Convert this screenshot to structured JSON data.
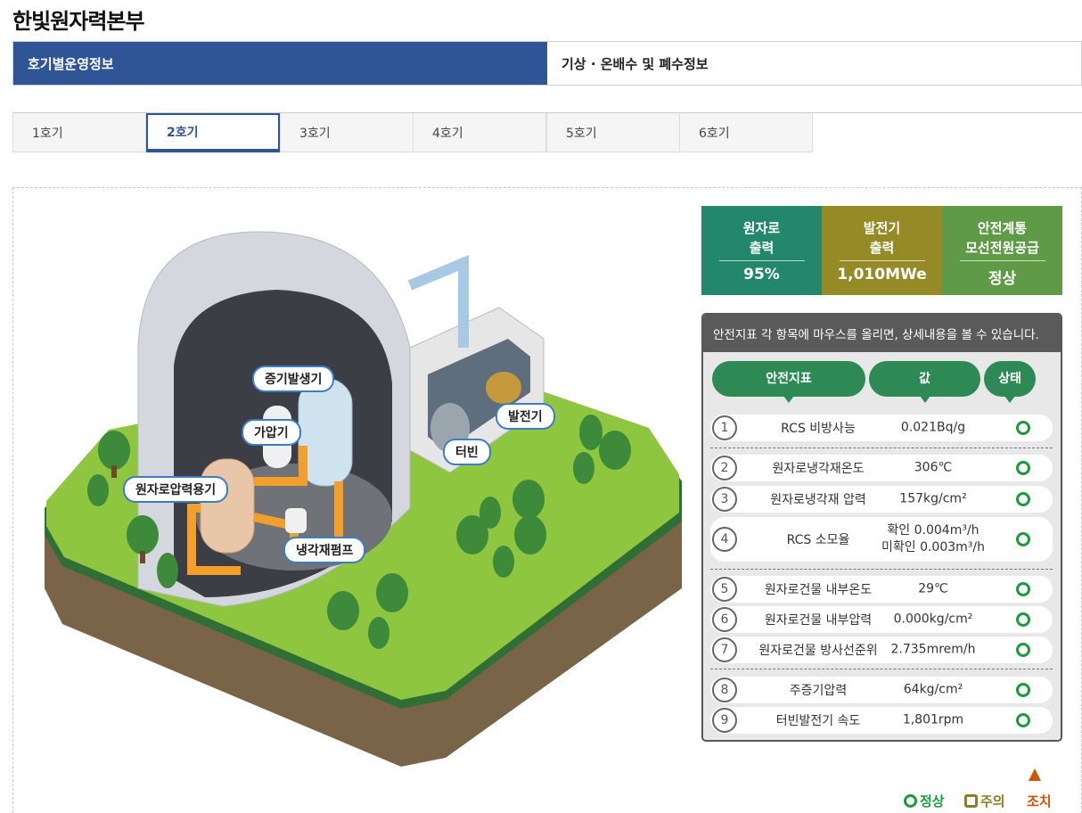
{
  "page": {
    "title": "한빛원자력본부"
  },
  "main_tabs": [
    {
      "label": "호기별운영정보",
      "active": true
    },
    {
      "label": "기상 · 온배수 및 폐수정보",
      "active": false
    }
  ],
  "unit_tabs": [
    {
      "label": "1호기",
      "active": false
    },
    {
      "label": "2호기",
      "active": true
    },
    {
      "label": "3호기",
      "active": false
    },
    {
      "label": "4호기",
      "active": false
    },
    {
      "label": "5호기",
      "active": false
    },
    {
      "label": "6호기",
      "active": false
    }
  ],
  "plant_labels": {
    "steam_generator": "증기발생기",
    "pressurizer": "가압기",
    "reactor_vessel": "원자로압력용기",
    "coolant_pump": "냉각재펌프",
    "turbine": "터빈",
    "generator": "발전기"
  },
  "summary": [
    {
      "label_line1": "원자로",
      "label_line2": "출력",
      "value": "95%",
      "color": "#23876b"
    },
    {
      "label_line1": "발전기",
      "label_line2": "출력",
      "value": "1,010MWe",
      "color": "#958a26"
    },
    {
      "label_line1": "안전계통",
      "label_line2": "모선전원공급",
      "value": "정상",
      "color": "#5f9b46"
    }
  ],
  "safety": {
    "header_text": "안전지표 각 항목에 마우스를 올리면, 상세내용을 볼 수 있습니다.",
    "columns": {
      "indicator": "안전지표",
      "value": "값",
      "status": "상태"
    },
    "rows": [
      {
        "num": "1",
        "name": "RCS 비방사능",
        "value": "0.021Bq/g",
        "value2": "",
        "status": "정상"
      },
      {
        "num": "2",
        "name": "원자로냉각재온도",
        "value": "306℃",
        "value2": "",
        "status": "정상"
      },
      {
        "num": "3",
        "name": "원자로냉각재 압력",
        "value": "157kg/cm²",
        "value2": "",
        "status": "정상"
      },
      {
        "num": "4",
        "name": "RCS 소모율",
        "value": "확인 0.004m³/h",
        "value2": "미확인 0.003m³/h",
        "status": "정상"
      },
      {
        "num": "5",
        "name": "원자로건물 내부온도",
        "value": "29℃",
        "value2": "",
        "status": "정상"
      },
      {
        "num": "6",
        "name": "원자로건물 내부압력",
        "value": "0.000kg/cm²",
        "value2": "",
        "status": "정상"
      },
      {
        "num": "7",
        "name": "원자로건물 방사선준위",
        "value": "2.735mrem/h",
        "value2": "",
        "status": "정상"
      },
      {
        "num": "8",
        "name": "주증기압력",
        "value": "64kg/cm²",
        "value2": "",
        "status": "정상"
      },
      {
        "num": "9",
        "name": "터빈발전기 속도",
        "value": "1,801rpm",
        "value2": "",
        "status": "정상"
      }
    ]
  },
  "legend": {
    "normal": "정상",
    "caution": "주의",
    "action": "조치",
    "colors": {
      "normal": "#1a9c3d",
      "caution": "#8b7d2a",
      "action": "#d35400"
    }
  }
}
